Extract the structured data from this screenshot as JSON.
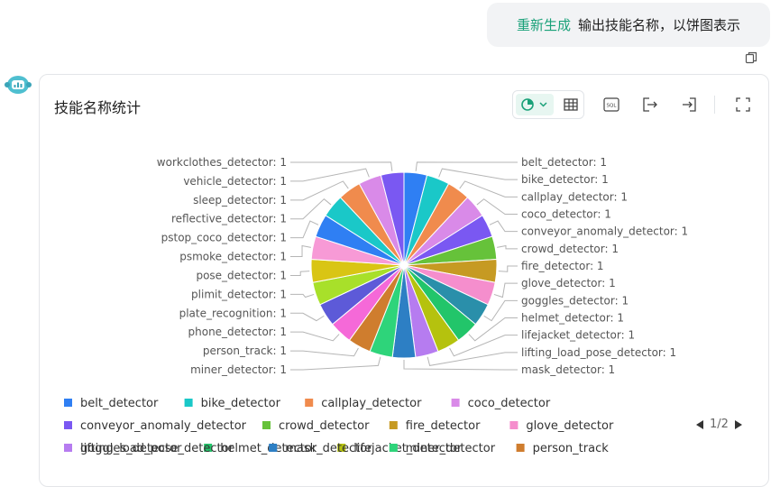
{
  "chat": {
    "user_message": {
      "regenerate_label": "重新生成",
      "text": "输出技能名称，以饼图表示"
    }
  },
  "card": {
    "title": "技能名称统计",
    "toolbar": {
      "pie_icon": "pie-chart-icon",
      "dropdown_icon": "chevron-down-icon",
      "table_icon": "table-icon",
      "sql_icon_text": "SQL",
      "export_icon": "export-icon",
      "import_icon": "import-icon",
      "fullscreen_icon": "fullscreen-icon"
    },
    "pager": {
      "text": "1/2"
    }
  },
  "chart_data": {
    "type": "pie",
    "slices": [
      {
        "label": "belt_detector",
        "value": 1,
        "color": "#2f7ff3"
      },
      {
        "label": "bike_detector",
        "value": 1,
        "color": "#1ac8c8"
      },
      {
        "label": "callplay_detector",
        "value": 1,
        "color": "#f08b4d"
      },
      {
        "label": "coco_detector",
        "value": 1,
        "color": "#d98ae8"
      },
      {
        "label": "conveyor_anomaly_detector",
        "value": 1,
        "color": "#7a58f2"
      },
      {
        "label": "crowd_detector",
        "value": 1,
        "color": "#66c23a"
      },
      {
        "label": "fire_detector",
        "value": 1,
        "color": "#c69a23"
      },
      {
        "label": "glove_detector",
        "value": 1,
        "color": "#f58ecd"
      },
      {
        "label": "goggles_detector",
        "value": 1,
        "color": "#2a8faa"
      },
      {
        "label": "helmet_detector",
        "value": 1,
        "color": "#22c56a"
      },
      {
        "label": "lifejacket_detector",
        "value": 1,
        "color": "#b5c20e"
      },
      {
        "label": "lifting_load_pose_detector",
        "value": 1,
        "color": "#b67cf0"
      },
      {
        "label": "mask_detector",
        "value": 1,
        "color": "#2d7fc4"
      },
      {
        "label": "miner_detector",
        "value": 1,
        "color": "#2ed47a"
      },
      {
        "label": "person_track",
        "value": 1,
        "color": "#cf7d2e"
      },
      {
        "label": "phone_detector",
        "value": 1,
        "color": "#f569d8"
      },
      {
        "label": "plate_recognition",
        "value": 1,
        "color": "#5d5ad8"
      },
      {
        "label": "plimit_detector",
        "value": 1,
        "color": "#a8e02a"
      },
      {
        "label": "pose_detector",
        "value": 1,
        "color": "#d9c514"
      },
      {
        "label": "psmoke_detector",
        "value": 1,
        "color": "#f79ad6"
      },
      {
        "label": "pstop_coco_detector",
        "value": 1,
        "color": "#2f7ff3"
      },
      {
        "label": "reflective_detector",
        "value": 1,
        "color": "#1ac8c8"
      },
      {
        "label": "sleep_detector",
        "value": 1,
        "color": "#f08b4d"
      },
      {
        "label": "vehicle_detector",
        "value": 1,
        "color": "#d98ae8"
      },
      {
        "label": "workclothes_detector",
        "value": 1,
        "color": "#7a58f2"
      }
    ],
    "legend_visible_count": 15,
    "legend_placement": "bottom"
  }
}
